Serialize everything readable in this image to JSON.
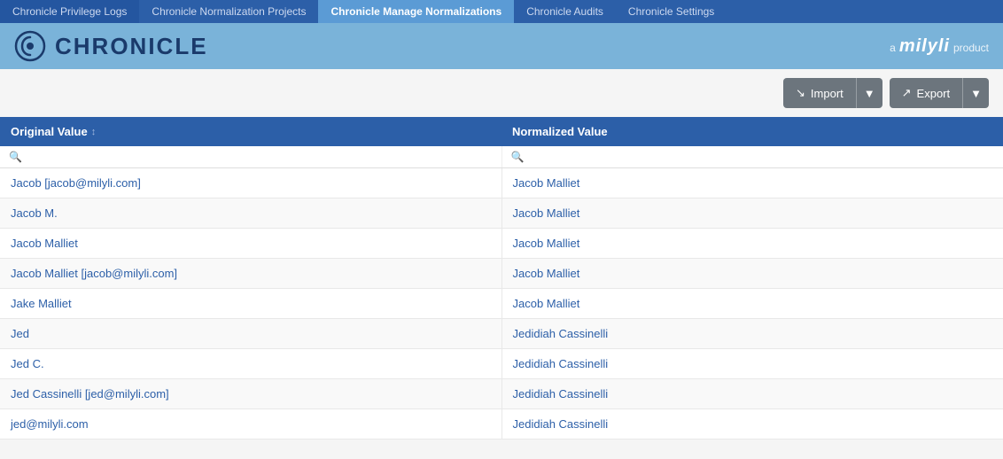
{
  "topNav": {
    "items": [
      {
        "label": "Chronicle Privilege Logs",
        "active": false
      },
      {
        "label": "Chronicle Normalization Projects",
        "active": false
      },
      {
        "label": "Chronicle Manage Normalizations",
        "active": true
      },
      {
        "label": "Chronicle Audits",
        "active": false
      },
      {
        "label": "Chronicle Settings",
        "active": false
      }
    ]
  },
  "header": {
    "logoText": "CHRONICLE",
    "milyli": "a milyli product"
  },
  "toolbar": {
    "importLabel": "Import",
    "exportLabel": "Export"
  },
  "table": {
    "columns": [
      {
        "label": "Original Value",
        "sortable": true
      },
      {
        "label": "Normalized Value",
        "sortable": false
      }
    ],
    "rows": [
      {
        "original": "Jacob [jacob@milyli.com]",
        "normalized": "Jacob Malliet"
      },
      {
        "original": "Jacob M.",
        "normalized": "Jacob Malliet"
      },
      {
        "original": "Jacob Malliet",
        "normalized": "Jacob Malliet"
      },
      {
        "original": "Jacob Malliet [jacob@milyli.com]",
        "normalized": "Jacob Malliet"
      },
      {
        "original": "Jake Malliet",
        "normalized": "Jacob Malliet"
      },
      {
        "original": "Jed",
        "normalized": "Jedidiah Cassinelli"
      },
      {
        "original": "Jed C.",
        "normalized": "Jedidiah Cassinelli"
      },
      {
        "original": "Jed Cassinelli [jed@milyli.com]",
        "normalized": "Jedidiah Cassinelli"
      },
      {
        "original": "jed@milyli.com",
        "normalized": "Jedidiah Cassinelli"
      }
    ]
  }
}
